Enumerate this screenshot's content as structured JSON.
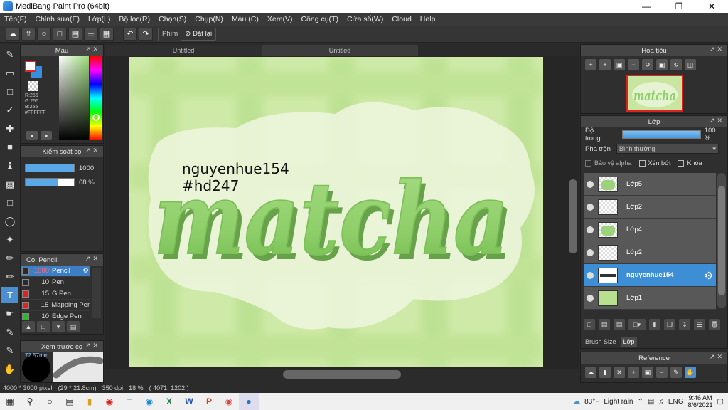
{
  "window": {
    "title": "MediBang Paint Pro (64bit)"
  },
  "menu": [
    "Tệp(F)",
    "Chỉnh sửa(E)",
    "Lớp(L)",
    "Bộ lọc(R)",
    "Chọn(S)",
    "Chụp(N)",
    "Màu (C)",
    "Xem(V)",
    "Công cụ(T)",
    "Cửa sổ(W)",
    "Cloud",
    "Help"
  ],
  "toolbar": {
    "shortcut_label": "Phím",
    "reset_label": "Đặt lại"
  },
  "color_panel": {
    "title": "Màu",
    "r": "R:255",
    "g": "G:255",
    "b": "B:255",
    "hex": "#FFFFFF"
  },
  "brush_control": {
    "title": "Kiểm soát cọ",
    "size_value": "1000",
    "size_fraction": 1.0,
    "opacity_value": "68 %",
    "opacity_fraction": 0.68
  },
  "brush_list": {
    "title": "Cọ: Pencil",
    "items": [
      {
        "size": "1000",
        "name": "Pencil",
        "color": "#2a2a2a"
      },
      {
        "size": "10",
        "name": "Pen",
        "color": "#2a2a2a"
      },
      {
        "size": "15",
        "name": "G Pen",
        "color": "#e02020"
      },
      {
        "size": "15",
        "name": "Mapping Pen",
        "color": "#e02020"
      },
      {
        "size": "10",
        "name": "Edge Pen",
        "color": "#20c020"
      }
    ]
  },
  "brush_preview": {
    "title": "Xem trước cọ",
    "size_label": "72.57mm"
  },
  "doc_tabs": [
    "Untitled",
    "Untitled"
  ],
  "canvas_content": {
    "username": "nguyenhue154",
    "tag": "#hd247",
    "word": "matcha"
  },
  "status": {
    "size": "4000 * 3000 pixel",
    "cm": "(29 * 21.8cm)",
    "dpi": "350 dpi",
    "zoom": "18 %",
    "coords": "( 4071, 1202 )"
  },
  "navigator": {
    "title": "Hoa tiêu",
    "thumb_text": "matcha"
  },
  "layer_panel": {
    "title": "Lớp",
    "opacity_label": "Độ trong",
    "opacity_value": "100 %",
    "blend_label": "Pha trộn",
    "blend_value": "Bình thường",
    "protect_alpha": "Bảo vệ alpha",
    "clipping": "Xén bớt",
    "lock": "Khóa",
    "layers": [
      {
        "name": "Lớp5",
        "selected": false
      },
      {
        "name": "Lớp2",
        "selected": false
      },
      {
        "name": "Lớp4",
        "selected": false
      },
      {
        "name": "Lớp2",
        "selected": false
      },
      {
        "name": "nguyenhue154",
        "selected": true
      },
      {
        "name": "Lớp1",
        "selected": false
      }
    ],
    "tab_brushsize": "Brush Size",
    "tab_layer": "Lớp"
  },
  "reference": {
    "title": "Reference"
  },
  "taskbar": {
    "temperature": "83°F",
    "weather": "Light rain",
    "lang": "ENG",
    "time": "9:46 AM",
    "date": "8/6/2021"
  }
}
